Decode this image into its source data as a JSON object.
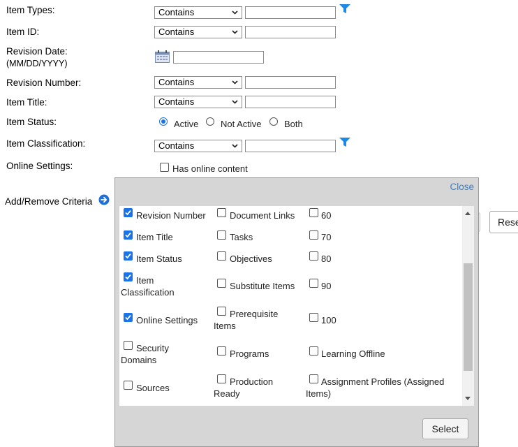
{
  "form": {
    "item_types": {
      "label": "Item Types:",
      "operator": "Contains",
      "value": ""
    },
    "item_id": {
      "label": "Item ID:",
      "operator": "Contains",
      "value": ""
    },
    "revision_date": {
      "label": "Revision Date:",
      "format": "(MM/DD/YYYY)",
      "value": ""
    },
    "revision_number": {
      "label": "Revision Number:",
      "operator": "Contains",
      "value": ""
    },
    "item_title": {
      "label": "Item Title:",
      "operator": "Contains",
      "value": ""
    },
    "item_status": {
      "label": "Item Status:",
      "options": [
        {
          "label": "Active",
          "selected": true
        },
        {
          "label": "Not Active",
          "selected": false
        },
        {
          "label": "Both",
          "selected": false
        }
      ]
    },
    "item_classification": {
      "label": "Item Classification:",
      "operator": "Contains",
      "value": ""
    },
    "online_settings": {
      "label": "Online Settings:",
      "checkbox_label": "Has online content",
      "checked": false
    },
    "add_remove_label": "Add/Remove Criteria",
    "reset_label": "Rese"
  },
  "popup": {
    "close_label": "Close",
    "select_label": "Select",
    "columns": [
      [
        {
          "label": "Revision Number",
          "checked": true
        },
        {
          "label": "Item Title",
          "checked": true
        },
        {
          "label": "Item Status",
          "checked": true
        },
        {
          "label": "Item Classification",
          "checked": true
        },
        {
          "label": "Online Settings",
          "checked": true
        },
        {
          "label": "Security Domains",
          "checked": false
        },
        {
          "label": "Sources",
          "checked": false
        }
      ],
      [
        {
          "label": "Document Links",
          "checked": false
        },
        {
          "label": "Tasks",
          "checked": false
        },
        {
          "label": "Objectives",
          "checked": false
        },
        {
          "label": "Substitute Items",
          "checked": false
        },
        {
          "label": "Prerequisite Items",
          "checked": false
        },
        {
          "label": "Programs",
          "checked": false
        },
        {
          "label": "Production Ready",
          "checked": false
        }
      ],
      [
        {
          "label": "60",
          "checked": false
        },
        {
          "label": "70",
          "checked": false
        },
        {
          "label": "80",
          "checked": false
        },
        {
          "label": "90",
          "checked": false
        },
        {
          "label": "100",
          "checked": false
        },
        {
          "label": "Learning Offline",
          "checked": false
        },
        {
          "label": "Assignment Profiles (Assigned Items)",
          "checked": false
        }
      ]
    ]
  },
  "icons": {
    "filter": "filter-icon",
    "calendar": "calendar-icon",
    "add_remove": "arrow-right-circle-icon"
  },
  "colors": {
    "accent": "#1a73e8",
    "link": "#3a7ec8",
    "popup_bg": "#d6d6d6"
  }
}
